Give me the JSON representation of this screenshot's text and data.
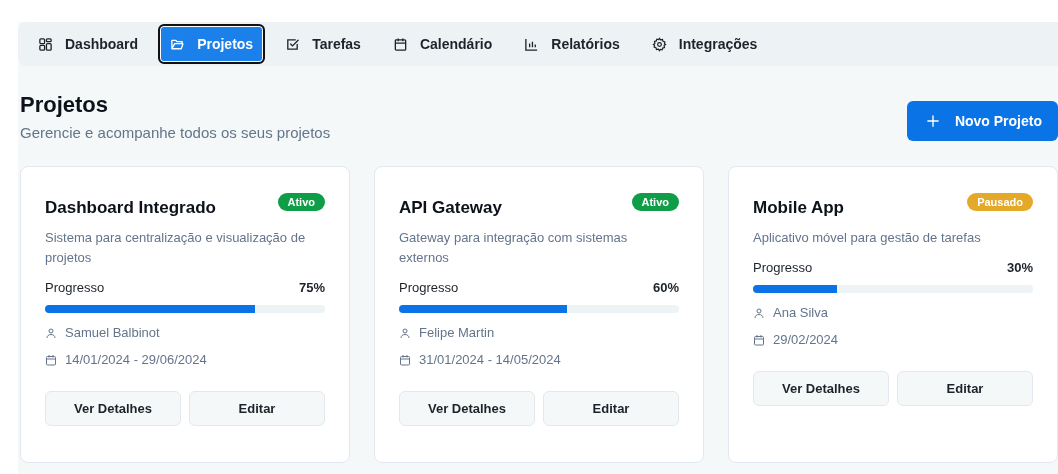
{
  "tabs": [
    {
      "label": "Dashboard",
      "selected": false
    },
    {
      "label": "Projetos",
      "selected": true
    },
    {
      "label": "Tarefas",
      "selected": false
    },
    {
      "label": "Calendário",
      "selected": false
    },
    {
      "label": "Relatórios",
      "selected": false
    },
    {
      "label": "Integrações",
      "selected": false
    }
  ],
  "header": {
    "title": "Projetos",
    "subtitle": "Gerencie e acompanhe todos os seus projetos",
    "button": "Novo Projeto"
  },
  "projects": [
    {
      "name": "Dashboard Integrado",
      "status": "Ativo",
      "color": "#0f9d47",
      "description": "Sistema para centralização e visualização de projetos",
      "progress_label": "Progresso",
      "percent": "75%",
      "level": 0.75,
      "owner": "Samuel Balbinot",
      "dates": "14/01/2024 - 29/06/2024",
      "actions": [
        "Ver Detalhes",
        "Editar"
      ]
    },
    {
      "name": "API Gateway",
      "status": "Ativo",
      "color": "#0f9d47",
      "description": "Gateway para integração com sistemas externos",
      "progress_label": "Progresso",
      "percent": "60%",
      "level": 0.6,
      "owner": "Felipe Martin",
      "dates": "31/01/2024 - 14/05/2024",
      "actions": [
        "Ver Detalhes",
        "Editar"
      ]
    },
    {
      "name": "Mobile App",
      "status": "Pausado",
      "color": "#e5a92a",
      "description": "Aplicativo móvel para gestão de tarefas",
      "progress_label": "Progresso",
      "percent": "30%",
      "level": 0.3,
      "owner": "Ana Silva",
      "dates": "29/02/2024",
      "actions": [
        "Ver Detalhes",
        "Editar"
      ]
    }
  ]
}
